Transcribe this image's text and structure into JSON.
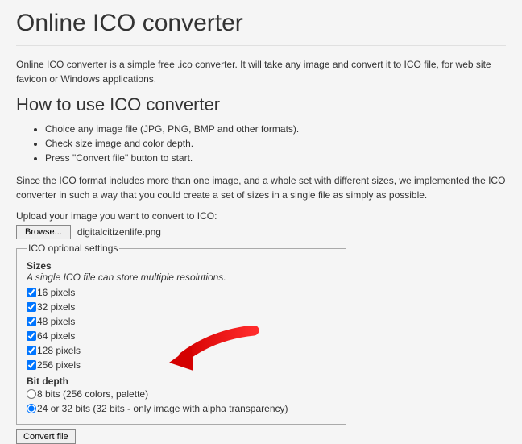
{
  "title": "Online ICO converter",
  "intro": "Online ICO converter is a simple free .ico converter. It will take any image and convert it to ICO file, for web site favicon or Windows applications.",
  "howto_heading": "How to use ICO converter",
  "instructions": [
    "Choice any image file (JPG, PNG, BMP and other formats).",
    "Check size image and color depth.",
    "Press \"Convert file\" button to start."
  ],
  "since_text": "Since the ICO format includes more than one image, and a whole set with different sizes, we implemented the ICO converter in such a way that you could create a set of sizes in a single file as simply as possible.",
  "upload_label": "Upload your image you want to convert to ICO:",
  "browse_label": "Browse...",
  "filename": "digitalcitizenlife.png",
  "fieldset_legend": "ICO optional settings",
  "sizes_heading": "Sizes",
  "sizes_sub": "A single ICO file can store multiple resolutions.",
  "sizes": [
    {
      "label": "16 pixels",
      "checked": true
    },
    {
      "label": "32 pixels",
      "checked": true
    },
    {
      "label": "48 pixels",
      "checked": true
    },
    {
      "label": "64 pixels",
      "checked": true
    },
    {
      "label": "128 pixels",
      "checked": true
    },
    {
      "label": "256 pixels",
      "checked": true
    }
  ],
  "bitdepth_heading": "Bit depth",
  "bitdepth_options": [
    {
      "label": "8 bits (256 colors, palette)",
      "checked": false
    },
    {
      "label": "24 or 32 bits (32 bits - only image with alpha transparency)",
      "checked": true
    }
  ],
  "convert_label": "Convert file"
}
